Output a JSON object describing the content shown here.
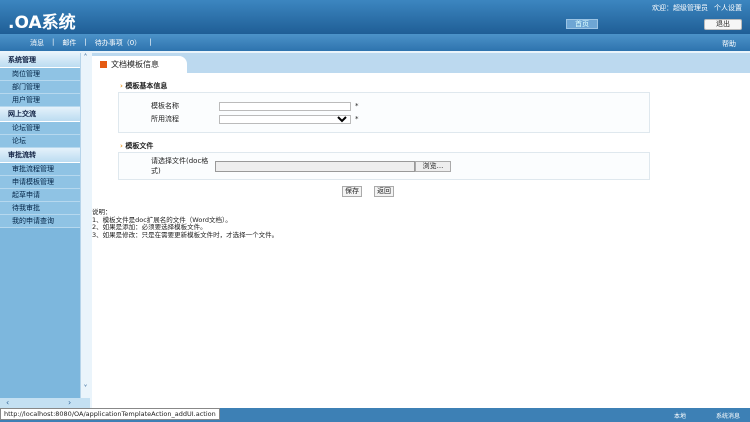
{
  "header": {
    "logo": ".OA系统",
    "welcome": "欢迎：超级管理员",
    "settings": "个人设置",
    "home": "首页",
    "logout": "退出"
  },
  "toolbar": {
    "items": [
      "消息",
      "邮件",
      "待办事项（0）"
    ],
    "help": "帮助"
  },
  "sidebar": [
    {
      "label": "系统管理",
      "items": [
        "岗位管理",
        "部门管理",
        "用户管理"
      ]
    },
    {
      "label": "网上交流",
      "items": [
        "论坛管理",
        "论坛"
      ]
    },
    {
      "label": "审批流转",
      "items": [
        "审批流程管理",
        "申请模板管理",
        "起草申请",
        "待我审批",
        "我的申请查询"
      ]
    }
  ],
  "page": {
    "title": "文档模板信息",
    "section1": "模板基本信息",
    "name_label": "模板名称",
    "flow_label": "所用流程",
    "required": "*",
    "section2": "模板文件",
    "file_label": "请选择文件(doc格式)",
    "browse": "浏览...",
    "save": "保存",
    "back": "返回",
    "notes": [
      "说明：",
      "1、模板文件是doc扩展名的文件（Word文档）。",
      "2、如果是添加：必须要选择模板文件。",
      "3、如果是修改：只是在需要更新模板文件时，才选择一个文件。"
    ]
  },
  "status": {
    "url": "http://localhost:8080/OA/applicationTemplateAction_addUI.action",
    "right1": "本地",
    "right2": "系统消息"
  }
}
